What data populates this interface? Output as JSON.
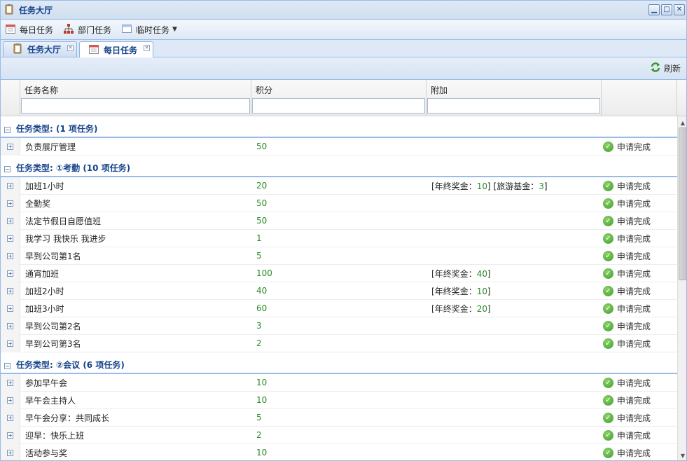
{
  "window": {
    "title": "任务大厅"
  },
  "toolbar": {
    "daily": "每日任务",
    "dept": "部门任务",
    "temp": "临时任务"
  },
  "tabs": [
    {
      "label": "任务大厅"
    },
    {
      "label": "每日任务"
    }
  ],
  "refresh": {
    "label": "刷新"
  },
  "columns": {
    "name": "任务名称",
    "score": "积分",
    "extra": "附加"
  },
  "groups": [
    {
      "header": "任务类型: (1 项任务)",
      "rows": [
        {
          "name": "负责展厅管理",
          "score": "50",
          "extra": [],
          "action": "申请完成"
        }
      ]
    },
    {
      "header": "任务类型: ①考勤 (10 项任务)",
      "rows": [
        {
          "name": "加班1小时",
          "score": "20",
          "extra": [
            [
              "年终奖金",
              "10"
            ],
            [
              "旅游基金",
              "3"
            ]
          ],
          "action": "申请完成"
        },
        {
          "name": "全勤奖",
          "score": "50",
          "extra": [],
          "action": "申请完成"
        },
        {
          "name": "法定节假日自愿值班",
          "score": "50",
          "extra": [],
          "action": "申请完成"
        },
        {
          "name": "我学习 我快乐 我进步",
          "score": "1",
          "extra": [],
          "action": "申请完成"
        },
        {
          "name": "早到公司第1名",
          "score": "5",
          "extra": [],
          "action": "申请完成"
        },
        {
          "name": "通宵加班",
          "score": "100",
          "extra": [
            [
              "年终奖金",
              "40"
            ]
          ],
          "action": "申请完成"
        },
        {
          "name": "加班2小时",
          "score": "40",
          "extra": [
            [
              "年终奖金",
              "10"
            ]
          ],
          "action": "申请完成"
        },
        {
          "name": "加班3小时",
          "score": "60",
          "extra": [
            [
              "年终奖金",
              "20"
            ]
          ],
          "action": "申请完成"
        },
        {
          "name": "早到公司第2名",
          "score": "3",
          "extra": [],
          "action": "申请完成"
        },
        {
          "name": "早到公司第3名",
          "score": "2",
          "extra": [],
          "action": "申请完成"
        }
      ]
    },
    {
      "header": "任务类型: ②会议 (6 项任务)",
      "rows": [
        {
          "name": "参加早午会",
          "score": "10",
          "extra": [],
          "action": "申请完成"
        },
        {
          "name": "早午会主持人",
          "score": "10",
          "extra": [],
          "action": "申请完成"
        },
        {
          "name": "早午会分享：共同成长",
          "score": "5",
          "extra": [],
          "action": "申请完成"
        },
        {
          "name": "迎早：快乐上班",
          "score": "2",
          "extra": [],
          "action": "申请完成"
        },
        {
          "name": "活动参与奖",
          "score": "10",
          "extra": [],
          "action": "申请完成"
        }
      ]
    }
  ],
  "colors": {
    "accent": "#15428b",
    "border": "#99bbe8",
    "score": "#2a8a2a"
  }
}
